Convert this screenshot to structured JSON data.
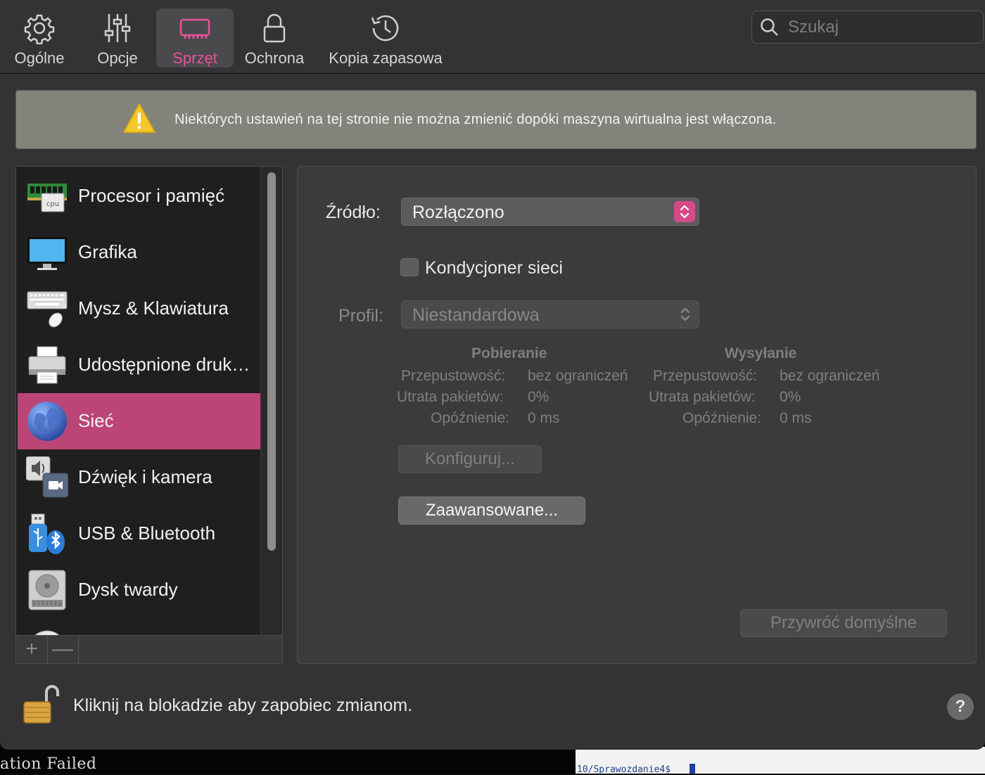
{
  "toolbar": {
    "items": [
      {
        "label": "Ogólne",
        "icon": "gear-icon"
      },
      {
        "label": "Opcje",
        "icon": "sliders-icon"
      },
      {
        "label": "Sprzęt",
        "icon": "hardware-chip-icon",
        "active": true
      },
      {
        "label": "Ochrona",
        "icon": "lock-icon"
      },
      {
        "label": "Kopia zapasowa",
        "icon": "history-clock-icon"
      }
    ],
    "search_placeholder": "Szukaj"
  },
  "banner": {
    "text": "Niektórych ustawień na tej stronie nie można zmienić dopóki maszyna wirtualna jest włączona.",
    "icon": "warning-icon"
  },
  "sidebar": {
    "items": [
      {
        "label": "Procesor i pamięć",
        "icon": "cpu-memory-icon"
      },
      {
        "label": "Grafika",
        "icon": "display-icon"
      },
      {
        "label": "Mysz & Klawiatura",
        "icon": "keyboard-mouse-icon"
      },
      {
        "label": "Udostępnione druk…",
        "icon": "printer-icon"
      },
      {
        "label": "Sieć",
        "icon": "globe-icon",
        "selected": true
      },
      {
        "label": "Dźwięk i kamera",
        "icon": "sound-camera-icon"
      },
      {
        "label": "USB & Bluetooth",
        "icon": "usb-bluetooth-icon"
      },
      {
        "label": "Dysk twardy",
        "icon": "hard-drive-icon"
      }
    ],
    "add_label": "+",
    "remove_label": "—"
  },
  "network": {
    "source_label": "Źródło:",
    "source_value": "Rozłączono",
    "conditioner_label": "Kondycjoner sieci",
    "conditioner_checked": false,
    "profile_label": "Profil:",
    "profile_value": "Niestandardowa",
    "download": {
      "heading": "Pobieranie",
      "bandwidth_label": "Przepustowość:",
      "bandwidth_value": "bez ograniczeń",
      "loss_label": "Utrata pakietów:",
      "loss_value": "0%",
      "delay_label": "Opóźnienie:",
      "delay_value": "0 ms"
    },
    "upload": {
      "heading": "Wysyłanie",
      "bandwidth_label": "Przepustowość:",
      "bandwidth_value": "bez ograniczeń",
      "loss_label": "Utrata pakietów:",
      "loss_value": "0%",
      "delay_label": "Opóźnienie:",
      "delay_value": "0 ms"
    },
    "configure_button": "Konfiguruj...",
    "advanced_button": "Zaawansowane...",
    "restore_button": "Przywróć domyślne"
  },
  "footer": {
    "lock_text": "Kliknij na blokadzie aby zapobiec zmianom.",
    "help_label": "?"
  },
  "background": {
    "terminal_left_text": "ation Failed",
    "terminal_right_text": "10/Sprawozdanie4$"
  },
  "colors": {
    "accent": "#e9519b",
    "selection": "#bc4577"
  }
}
